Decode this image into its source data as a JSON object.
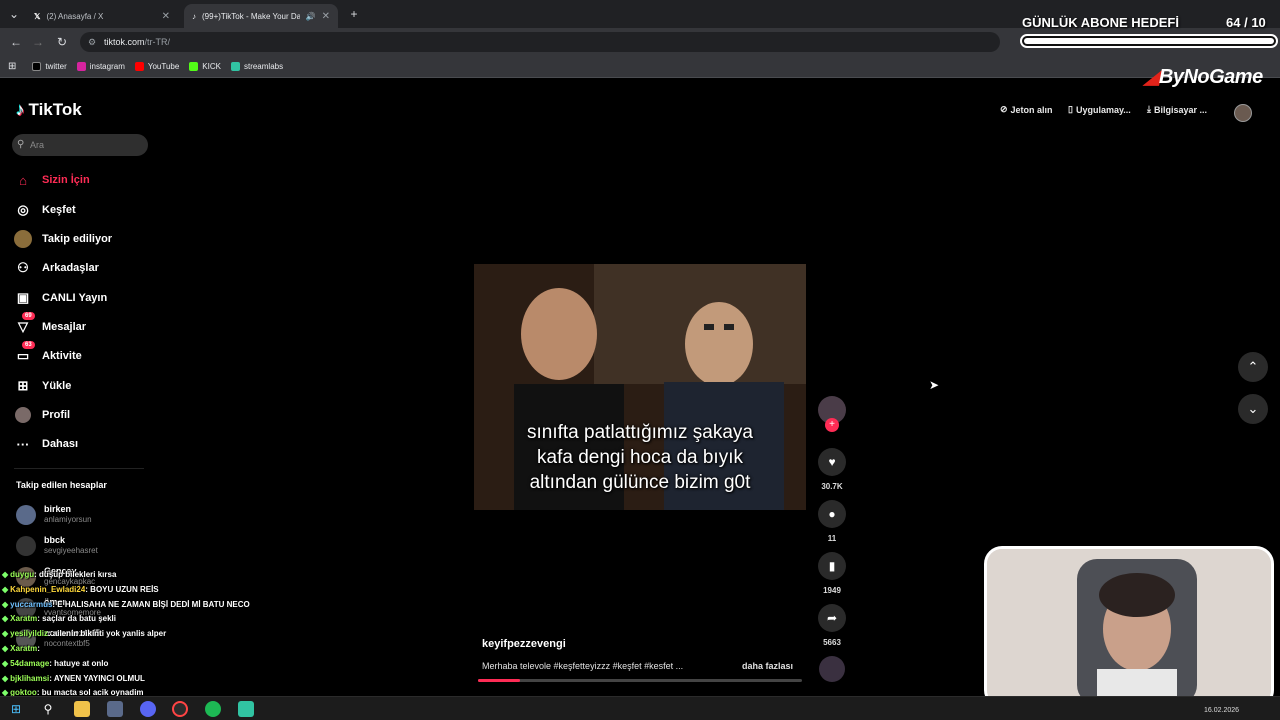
{
  "browser": {
    "tabs": [
      {
        "label": "(2) Anasayfa / X",
        "active": false
      },
      {
        "label": "(99+)TikTok - Make Your Da",
        "active": true
      }
    ],
    "url_host": "tiktok.com",
    "url_path": "/tr-TR/",
    "bookmarks": [
      "twitter",
      "instagram",
      "YouTube",
      "KICK",
      "streamlabs"
    ]
  },
  "tiktok": {
    "logo": "TikTok",
    "search_placeholder": "Ara",
    "nav": [
      {
        "label": "Sizin İçin",
        "icon": "home-icon",
        "active": true
      },
      {
        "label": "Keşfet",
        "icon": "compass-icon"
      },
      {
        "label": "Takip ediliyor",
        "icon": "following-avatar-icon"
      },
      {
        "label": "Arkadaşlar",
        "icon": "friends-icon"
      },
      {
        "label": "CANLI Yayın",
        "icon": "live-icon"
      },
      {
        "label": "Mesajlar",
        "icon": "messages-icon",
        "badge": "69"
      },
      {
        "label": "Aktivite",
        "icon": "activity-icon",
        "badge": "63"
      },
      {
        "label": "Yükle",
        "icon": "upload-icon"
      },
      {
        "label": "Profil",
        "icon": "profile-icon"
      },
      {
        "label": "Dahası",
        "icon": "more-icon"
      }
    ],
    "following_title": "Takip edilen hesaplar",
    "following": [
      {
        "name": "birken",
        "user": "anlamiyorsun"
      },
      {
        "name": "bbck",
        "user": "sevgiyeehasret"
      },
      {
        "name": "Gencay",
        "user": "gencaykapkac"
      },
      {
        "name": "ömer",
        "user": "vvantsomemore"
      },
      {
        "name": "nocontextbf5",
        "user": "nocontextbf5"
      }
    ],
    "header_actions": [
      "Jeton alın",
      "Uygulamay...",
      "Bilgisayar ..."
    ],
    "video": {
      "caption_lines": [
        "sınıfta patlattığımız şakaya",
        "kafa dengi hoca da bıyık",
        "altından gülünce bizim g0t"
      ],
      "author": "keyifpezzevengi",
      "description": "Merhaba televole #keşfetteyizzz #keşfet #kesfet ...",
      "more_label": "daha fazlası",
      "progress": 0.13,
      "likes": "30.7K",
      "comments": "11",
      "saves": "1949",
      "shares": "5663"
    }
  },
  "overlay": {
    "goal_title": "GÜNLÜK ABONE HEDEFİ",
    "goal_count": "64",
    "goal_total": "/ 10",
    "goal_progress": 1.0,
    "brand": "ByNoGame",
    "chat": [
      {
        "user": "duygu",
        "msg": ": düşüp bilekleri kırsa",
        "color": "g"
      },
      {
        "user": "Kahpenin_Ewladi24",
        "msg": ": BOYU UZUN REİS",
        "color": "y"
      },
      {
        "user": "yuccarmus",
        "msg": ": E HALISAHA NE ZAMAN BİŞİ DEDİ Mİ BATU NECO",
        "color": "b"
      },
      {
        "user": "Xaratm",
        "msg": ": saçlar da batu şekli",
        "color": "g"
      },
      {
        "user": "yesilyildiz",
        "msg": ": ailenin bikinti yok yanlis alper",
        "color": "g"
      },
      {
        "user": "Xaratm",
        "msg": ": ",
        "color": "g"
      },
      {
        "user": "54damage",
        "msg": ": hatuye at onlo",
        "color": "g"
      },
      {
        "user": "bjklihamsi",
        "msg": ": AYNEN YAYINCI OLMUL",
        "color": "g"
      },
      {
        "user": "goktoo",
        "msg": ": bu macta sol acik oynadim",
        "color": "g"
      }
    ]
  },
  "taskbar": {
    "date": "16.02.2026"
  },
  "colors": {
    "accent": "#fe2c55",
    "bg": "#000000",
    "chrome": "#35363a"
  }
}
